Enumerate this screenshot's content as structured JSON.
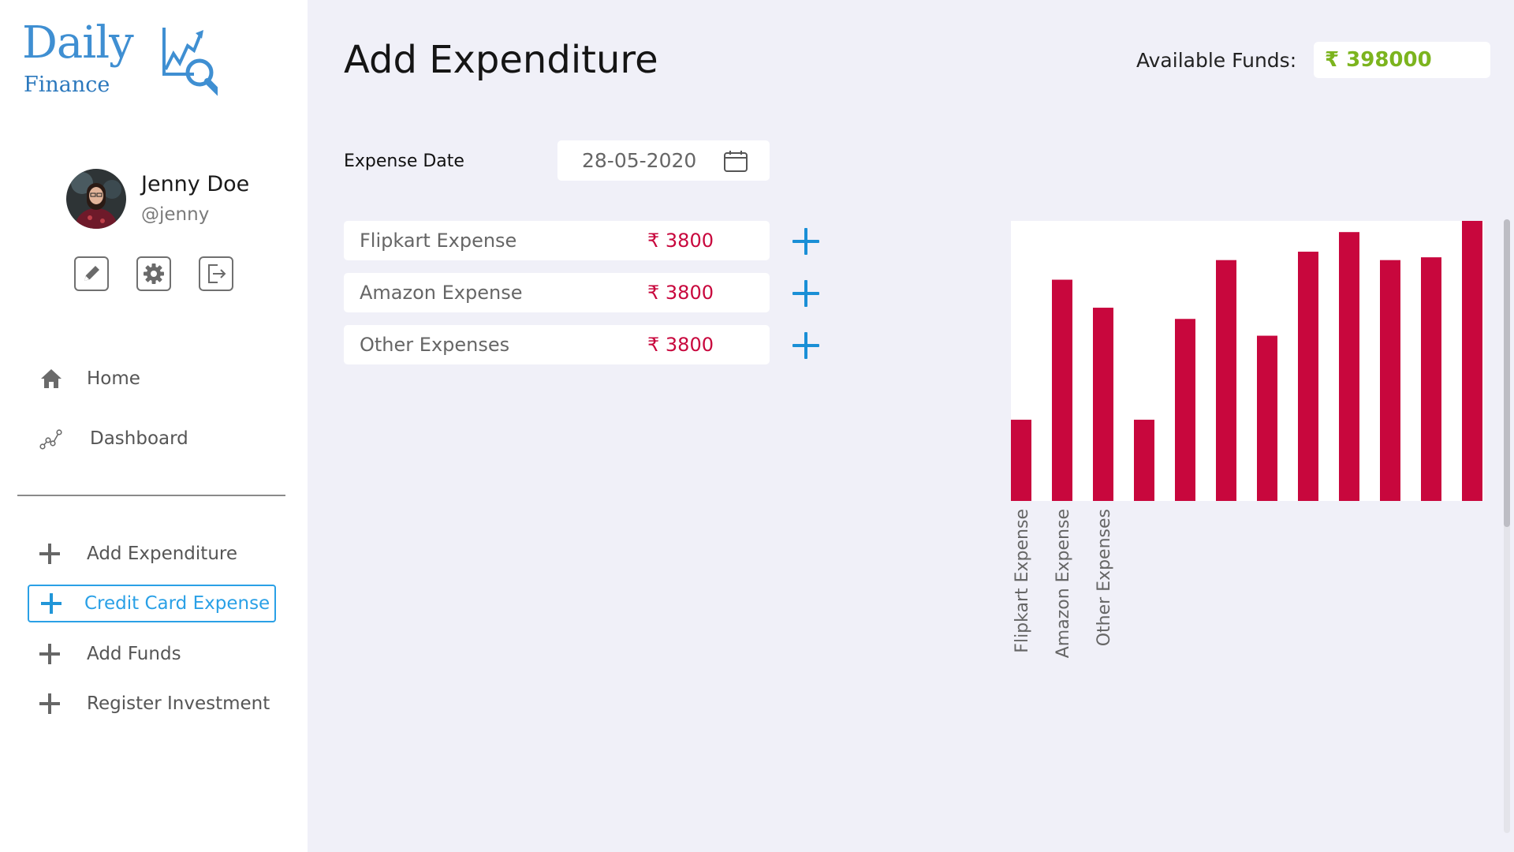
{
  "app": {
    "logo_daily": "Daily",
    "logo_finance": "Finance"
  },
  "user": {
    "name": "Jenny Doe",
    "handle": "@jenny"
  },
  "profile_actions": [
    "edit-icon",
    "settings-icon",
    "logout-icon"
  ],
  "nav": {
    "home": "Home",
    "dashboard": "Dashboard"
  },
  "actions": {
    "add_expenditure": "Add Expenditure",
    "credit_card_expense": "Credit Card Expense",
    "add_funds": "Add Funds",
    "register_investment": "Register Investment"
  },
  "header": {
    "title": "Add Expenditure",
    "funds_label": "Available Funds:",
    "funds_value": "₹ 398000"
  },
  "form": {
    "date_label": "Expense Date",
    "date_value": "28-05-2020",
    "expenses": [
      {
        "name": "Flipkart Expense",
        "amount": "₹ 3800"
      },
      {
        "name": "Amazon Expense",
        "amount": "₹ 3800"
      },
      {
        "name": "Other Expenses",
        "amount": "₹ 3800"
      }
    ]
  },
  "colors": {
    "accent": "#2aa0e6",
    "bar": "#c8073d",
    "funds": "#7cb41e",
    "background": "#f0f0f8"
  },
  "chart_data": {
    "type": "bar",
    "categories": [
      "Flipkart Expense",
      "Amazon Expense",
      "Other Expenses",
      "",
      "",
      "",
      "",
      "",
      "",
      "",
      "",
      ""
    ],
    "values": [
      29,
      79,
      69,
      29,
      65,
      86,
      59,
      89,
      96,
      86,
      87,
      100
    ],
    "ylim": [
      0,
      100
    ],
    "grid": false,
    "legend": "none"
  }
}
